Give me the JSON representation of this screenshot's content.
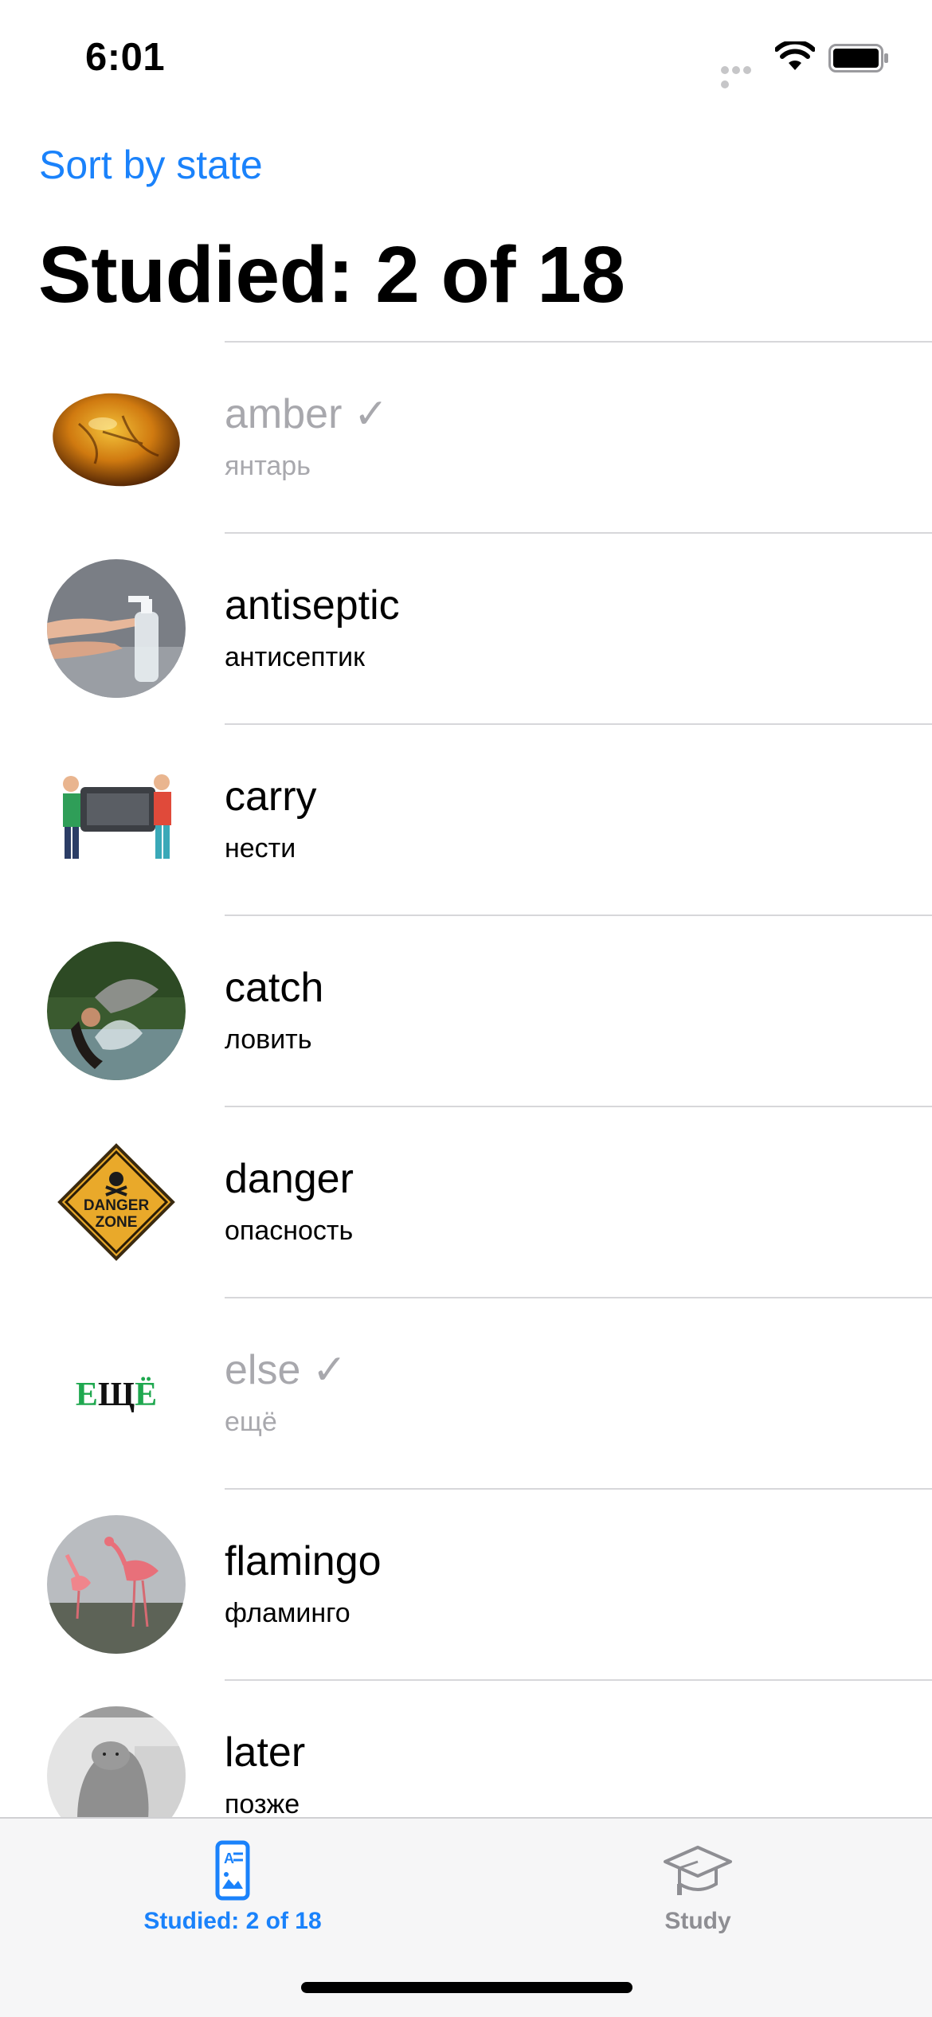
{
  "status_bar": {
    "time": "6:01"
  },
  "nav": {
    "sort_label": "Sort by state"
  },
  "header": {
    "title": "Studied: 2 of 18"
  },
  "words": [
    {
      "word": "amber ✓",
      "translation": "янтарь",
      "studied": true,
      "image": "amber-stone-icon"
    },
    {
      "word": "antiseptic",
      "translation": "антисептик",
      "studied": false,
      "image": "sanitizer-hands-icon"
    },
    {
      "word": "carry",
      "translation": "нести",
      "studied": false,
      "image": "two-people-carrying-icon"
    },
    {
      "word": "catch",
      "translation": "ловить",
      "studied": false,
      "image": "woman-catching-fish-icon"
    },
    {
      "word": "danger",
      "translation": "опасность",
      "studied": false,
      "image": "danger-zone-sign-icon",
      "sign_text": [
        "DANGER",
        "ZONE"
      ]
    },
    {
      "word": "else ✓",
      "translation": "ещё",
      "studied": true,
      "image": "eshchyo-word-icon",
      "image_text": "ЕЩЁ"
    },
    {
      "word": "flamingo",
      "translation": "фламинго",
      "studied": false,
      "image": "flamingo-icon"
    },
    {
      "word": "later",
      "translation": "позже",
      "studied": false,
      "image": "seal-creature-icon"
    }
  ],
  "tab_bar": {
    "tabs": [
      {
        "label": "Studied: 2 of 18",
        "icon": "flashcard-list-icon",
        "active": true
      },
      {
        "label": "Study",
        "icon": "graduation-cap-icon",
        "active": false
      }
    ]
  },
  "colors": {
    "accent": "#1a82fb",
    "studied_text": "#a8a8ad",
    "divider": "#d7d7da",
    "inactive_tab": "#8e8e93"
  }
}
